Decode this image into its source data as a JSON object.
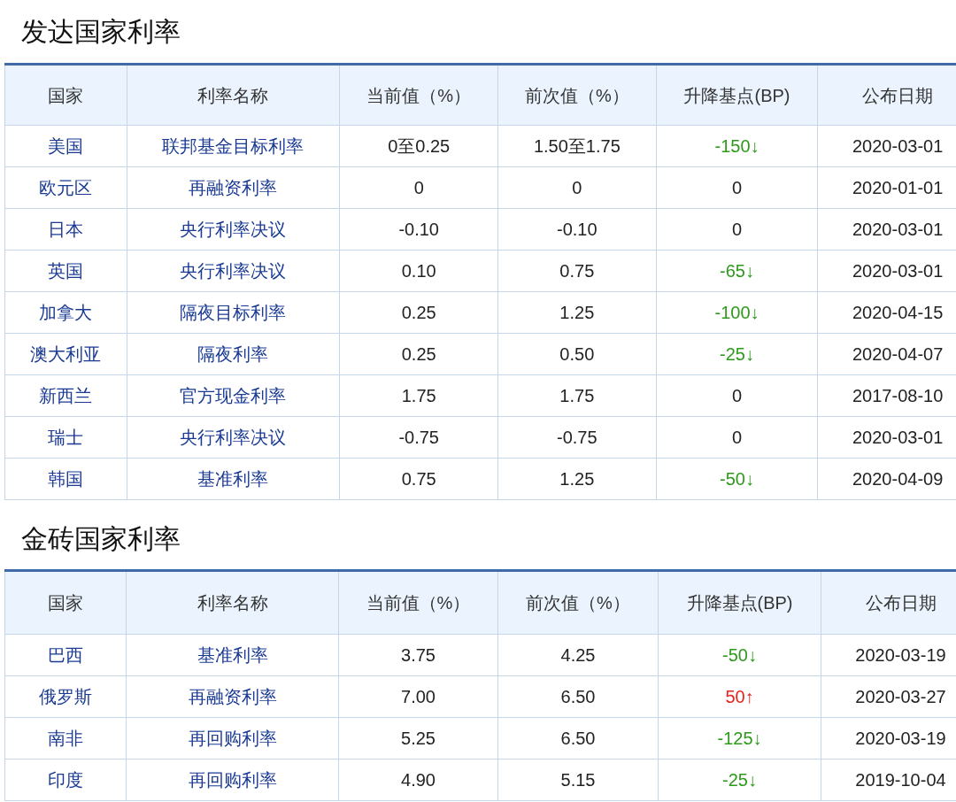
{
  "sections": [
    {
      "title": "发达国家利率",
      "columns": [
        "国家",
        "利率名称",
        "当前值（%）",
        "前次值（%）",
        "升降基点(BP)",
        "公布日期"
      ],
      "rows": [
        {
          "country": "美国",
          "rate_name": "联邦基金目标利率",
          "current": "0至0.25",
          "previous": "1.50至1.75",
          "bp": "-150↓",
          "kind": "down",
          "date": "2020-03-01"
        },
        {
          "country": "欧元区",
          "rate_name": "再融资利率",
          "current": "0",
          "previous": "0",
          "bp": "0",
          "kind": "flat",
          "date": "2020-01-01"
        },
        {
          "country": "日本",
          "rate_name": "央行利率决议",
          "current": "-0.10",
          "previous": "-0.10",
          "bp": "0",
          "kind": "flat",
          "date": "2020-03-01"
        },
        {
          "country": "英国",
          "rate_name": "央行利率决议",
          "current": "0.10",
          "previous": "0.75",
          "bp": "-65↓",
          "kind": "down",
          "date": "2020-03-01"
        },
        {
          "country": "加拿大",
          "rate_name": "隔夜目标利率",
          "current": "0.25",
          "previous": "1.25",
          "bp": "-100↓",
          "kind": "down",
          "date": "2020-04-15"
        },
        {
          "country": "澳大利亚",
          "rate_name": "隔夜利率",
          "current": "0.25",
          "previous": "0.50",
          "bp": "-25↓",
          "kind": "down",
          "date": "2020-04-07"
        },
        {
          "country": "新西兰",
          "rate_name": "官方现金利率",
          "current": "1.75",
          "previous": "1.75",
          "bp": "0",
          "kind": "flat",
          "date": "2017-08-10"
        },
        {
          "country": "瑞士",
          "rate_name": "央行利率决议",
          "current": "-0.75",
          "previous": "-0.75",
          "bp": "0",
          "kind": "flat",
          "date": "2020-03-01"
        },
        {
          "country": "韩国",
          "rate_name": "基准利率",
          "current": "0.75",
          "previous": "1.25",
          "bp": "-50↓",
          "kind": "down",
          "date": "2020-04-09"
        }
      ]
    },
    {
      "title": "金砖国家利率",
      "columns": [
        "国家",
        "利率名称",
        "当前值（%）",
        "前次值（%）",
        "升降基点(BP)",
        "公布日期"
      ],
      "rows": [
        {
          "country": "巴西",
          "rate_name": "基准利率",
          "current": "3.75",
          "previous": "4.25",
          "bp": "-50↓",
          "kind": "down",
          "date": "2020-03-19"
        },
        {
          "country": "俄罗斯",
          "rate_name": "再融资利率",
          "current": "7.00",
          "previous": "6.50",
          "bp": "50↑",
          "kind": "up",
          "date": "2020-03-27"
        },
        {
          "country": "南非",
          "rate_name": "再回购利率",
          "current": "5.25",
          "previous": "6.50",
          "bp": "-125↓",
          "kind": "down",
          "date": "2020-03-19"
        },
        {
          "country": "印度",
          "rate_name": "再回购利率",
          "current": "4.90",
          "previous": "5.15",
          "bp": "-25↓",
          "kind": "down",
          "date": "2019-10-04"
        }
      ]
    }
  ]
}
